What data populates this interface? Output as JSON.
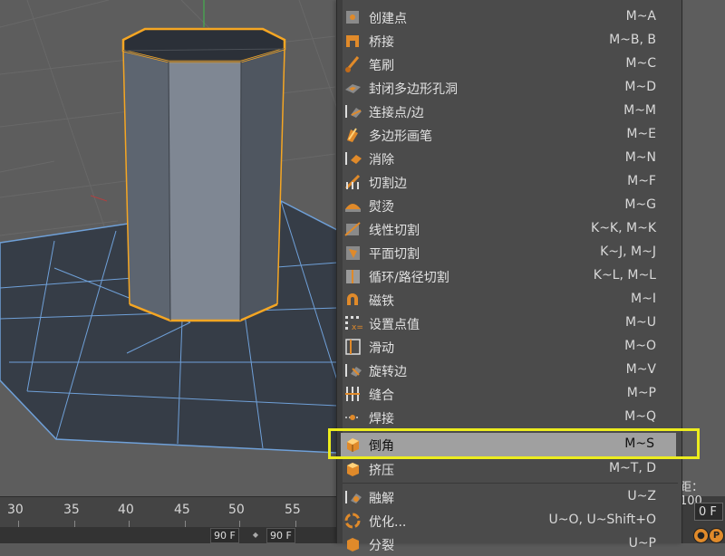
{
  "timeline": {
    "ticks": [
      "30",
      "35",
      "40",
      "45",
      "50",
      "55"
    ],
    "start_frame": "90 F",
    "end_frame": "90 F",
    "current_frame": "0 F",
    "side_label": "距：100"
  },
  "menu": {
    "items": [
      {
        "label": "创建点",
        "shortcut": "M~A",
        "icon": "create-point-icon"
      },
      {
        "label": "桥接",
        "shortcut": "M~B, B",
        "icon": "bridge-icon"
      },
      {
        "label": "笔刷",
        "shortcut": "M~C",
        "icon": "brush-icon"
      },
      {
        "label": "封闭多边形孔洞",
        "shortcut": "M~D",
        "icon": "close-polygon-hole-icon"
      },
      {
        "label": "连接点/边",
        "shortcut": "M~M",
        "icon": "connect-points-edges-icon"
      },
      {
        "label": "多边形画笔",
        "shortcut": "M~E",
        "icon": "polygon-pen-icon"
      },
      {
        "label": "消除",
        "shortcut": "M~N",
        "icon": "dissolve-icon"
      },
      {
        "label": "切割边",
        "shortcut": "M~F",
        "icon": "edge-cut-icon"
      },
      {
        "label": "熨烫",
        "shortcut": "M~G",
        "icon": "iron-icon"
      },
      {
        "label": "线性切割",
        "shortcut": "K~K, M~K",
        "icon": "line-cut-icon"
      },
      {
        "label": "平面切割",
        "shortcut": "K~J, M~J",
        "icon": "plane-cut-icon"
      },
      {
        "label": "循环/路径切割",
        "shortcut": "K~L, M~L",
        "icon": "loop-path-cut-icon"
      },
      {
        "label": "磁铁",
        "shortcut": "M~I",
        "icon": "magnet-icon"
      },
      {
        "label": "设置点值",
        "shortcut": "M~U",
        "icon": "set-point-value-icon"
      },
      {
        "label": "滑动",
        "shortcut": "M~O",
        "icon": "slide-icon"
      },
      {
        "label": "旋转边",
        "shortcut": "M~V",
        "icon": "spin-edge-icon"
      },
      {
        "label": "缝合",
        "shortcut": "M~P",
        "icon": "stitch-icon"
      },
      {
        "label": "焊接",
        "shortcut": "M~Q",
        "icon": "weld-icon"
      },
      {
        "label": "倒角",
        "shortcut": "M~S",
        "icon": "bevel-icon"
      },
      {
        "label": "挤压",
        "shortcut": "M~T, D",
        "icon": "extrude-icon"
      },
      {
        "label": "融解",
        "shortcut": "U~Z",
        "icon": "melt-icon"
      },
      {
        "label": "优化...",
        "shortcut": "U~O, U~Shift+O",
        "icon": "optimize-icon"
      },
      {
        "label": "分裂",
        "shortcut": "U~P",
        "icon": "split-icon"
      }
    ],
    "highlighted_label": "倒角"
  },
  "colors": {
    "selection_outline": "#f5a623",
    "highlight_box": "#ecec1e",
    "menu_bg": "#4b4b4b",
    "plane_grid": "#6fa0d8"
  }
}
